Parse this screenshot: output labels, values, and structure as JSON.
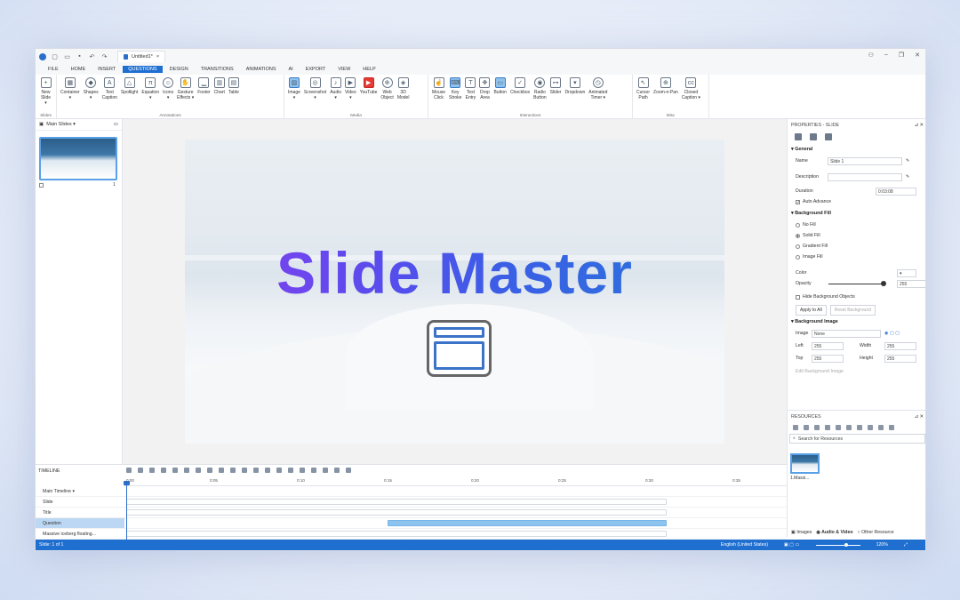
{
  "titlebar": {
    "doc_title": "Untitled1*",
    "close": "×"
  },
  "menu": [
    "FILE",
    "HOME",
    "INSERT",
    "QUESTIONS",
    "DESIGN",
    "TRANSITIONS",
    "ANIMATIONS",
    "AI",
    "EXPORT",
    "VIEW",
    "HELP"
  ],
  "ribbon": {
    "slides": {
      "label": "Slides",
      "buttons": [
        "New\nSlide ▾"
      ]
    },
    "annotations": {
      "label": "Annotations",
      "buttons": [
        "Container\n▾",
        "Shapes\n▾",
        "Text\nCaption",
        "Spotlight",
        "Equation\n▾",
        "Icons\n▾",
        "Gesture\nEffects ▾",
        "Footer",
        "Chart",
        "Table"
      ]
    },
    "media": {
      "label": "Media",
      "buttons": [
        "Image\n▾",
        "Screenshot\n▾",
        "Audio\n▾",
        "Video\n▾",
        "YouTube",
        "Web\nObject",
        "3D\nModel"
      ]
    },
    "interactions": {
      "label": "Interactions",
      "buttons": [
        "Mouse\nClick",
        "Key\nStroke",
        "Text\nEntry",
        "Drop\nArea",
        "Button",
        "Checkbox",
        "Radio\nButton",
        "Slider",
        "Dropdown",
        "Animated\nTimer ▾"
      ]
    },
    "misc": {
      "label": "Misc",
      "buttons": [
        "Cursor\nPath",
        "Zoom-n-Pan",
        "Closed\nCaption ▾"
      ]
    }
  },
  "left_panel": {
    "title": "Main Slides ▾",
    "slide_number": "1"
  },
  "slide": {
    "title": "Slide Master"
  },
  "properties": {
    "header": "PROPERTIES - SLIDE",
    "general": {
      "title": "General",
      "name_label": "Name",
      "name_value": "Slide 1",
      "description_label": "Description",
      "description_value": "",
      "duration_label": "Duration",
      "duration_value": "0:03:08",
      "auto_advance": "Auto Advance"
    },
    "background_fill": {
      "title": "Background Fill",
      "options": [
        "No Fill",
        "Solid Fill",
        "Gradient Fill",
        "Image Fill"
      ],
      "selected": "Solid Fill",
      "color_label": "Color",
      "opacity_label": "Opacity",
      "opacity_value": "255",
      "hide_bg": "Hide Background Objects",
      "apply_all": "Apply to All",
      "reset": "Reset Background"
    },
    "background_image": {
      "title": "Background Image",
      "image_label": "Image",
      "image_value": "None",
      "left_label": "Left",
      "left_value": "255",
      "width_label": "Width",
      "width_value": "255",
      "top_label": "Top",
      "top_value": "255",
      "height_label": "Height",
      "height_value": "255",
      "edit": "Edit Background Image"
    }
  },
  "resources": {
    "header": "RESOURCES",
    "search_placeholder": "Search for Resources",
    "item_name": "1.Massi...",
    "tabs": [
      "Images",
      "Audio & Video",
      "Other Resource"
    ]
  },
  "timeline": {
    "header": "TIMELINE",
    "ruler": [
      "0:00",
      "0:05",
      "0:10",
      "0:15",
      "0:20",
      "0:25",
      "0:30",
      "0:35"
    ],
    "rows": [
      {
        "name": "Main Timeline ▾"
      },
      {
        "name": "Slide"
      },
      {
        "name": "Title"
      },
      {
        "name": "Question"
      },
      {
        "name": "Massive iceberg floating..."
      }
    ]
  },
  "status": {
    "left": "Slide: 1 of 1",
    "language": "English (United States)",
    "zoom": "120%"
  }
}
